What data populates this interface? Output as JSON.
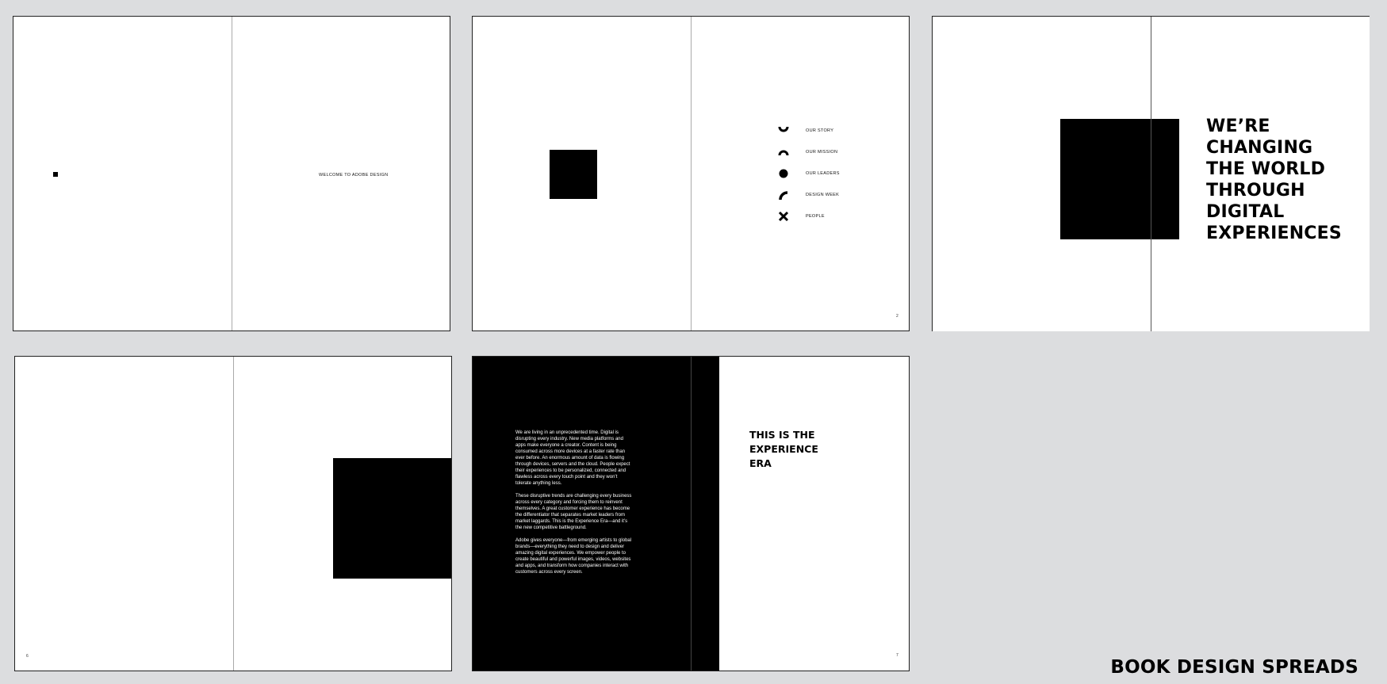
{
  "spread1": {
    "welcome_text": "WELCOME TO ADOBE DESIGN"
  },
  "spread2": {
    "menu": [
      {
        "icon": "arc-bottom-icon",
        "label": "OUR STORY"
      },
      {
        "icon": "arc-top-icon",
        "label": "OUR MISSION"
      },
      {
        "icon": "circle-icon",
        "label": "OUR LEADERS"
      },
      {
        "icon": "quarter-arc-icon",
        "label": "DESIGN WEEK"
      },
      {
        "icon": "x-mark-icon",
        "label": "PEOPLE"
      }
    ],
    "page_number": "2"
  },
  "spread3": {
    "headline": [
      "WE’RE",
      "CHANGING",
      "THE WORLD",
      "THROUGH",
      "DIGITAL",
      "EXPERIENCES"
    ]
  },
  "spread4": {
    "page_number": "6"
  },
  "spread5": {
    "body": [
      "We are living in an unprecedented time. Digital is disrupting every industry. New media platforms and apps make everyone a creator. Content is being consumed across more devices at a faster rate than ever before. An enormous amount of data is flowing through devices, servers and the cloud. People expect their experiences to be personalized, connected and flawless across every touch point and they won’t tolerate anything less.",
      "These disruptive trends are challenging every business across every category and forcing them to reinvent themselves. A great customer experience has become the differentiator that separates market leaders from market laggards. This is the Experience Era—and it’s the new competitive battleground.",
      "Adobe gives everyone—from emerging artists to global brands—everything they need to design and deliver amazing digital experiences. We empower people to create beautiful and powerful images, videos, websites and apps, and transform how companies interact with customers across every screen."
    ],
    "heading": [
      "THIS IS THE",
      "EXPERIENCE",
      "ERA"
    ],
    "page_number": "7"
  },
  "footer": {
    "title": "BOOK DESIGN SPREADS"
  }
}
